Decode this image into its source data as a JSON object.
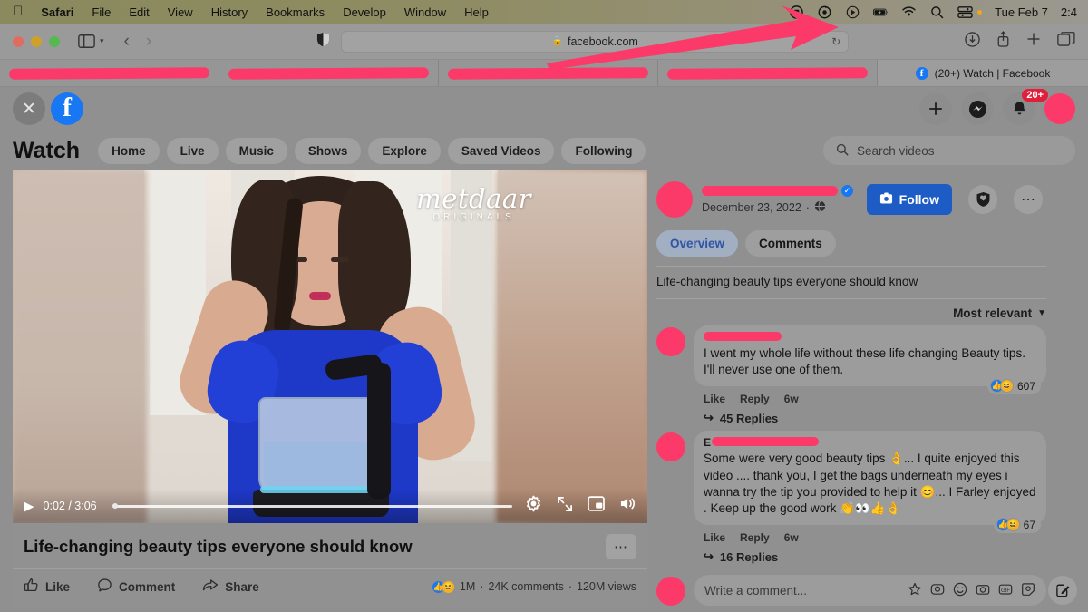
{
  "menubar": {
    "apple_icon": "apple-icon",
    "items": [
      {
        "label": "Safari",
        "bold": true
      },
      {
        "label": "File",
        "bold": false
      },
      {
        "label": "Edit",
        "bold": false
      },
      {
        "label": "View",
        "bold": false
      },
      {
        "label": "History",
        "bold": false
      },
      {
        "label": "Bookmarks",
        "bold": false
      },
      {
        "label": "Develop",
        "bold": false
      },
      {
        "label": "Window",
        "bold": false
      },
      {
        "label": "Help",
        "bold": false
      }
    ],
    "status_icons": [
      "record-stop-icon",
      "time-machine-icon",
      "screen-record-icon",
      "battery-charging-icon",
      "wifi-icon",
      "spotlight-search-icon",
      "control-center-icon"
    ],
    "clock": "Tue Feb 7",
    "time_partial": "2:4"
  },
  "safari": {
    "traffic_lights": [
      "close-button",
      "minimize-button",
      "zoom-button"
    ],
    "sidebar_icon": "sidebar-toggle-icon",
    "back_icon": "back-arrow-icon",
    "forward_icon": "forward-arrow-icon",
    "shield_icon": "privacy-shield-icon",
    "url": "facebook.com",
    "lock_icon": "lock-icon",
    "reload_icon": "reload-icon",
    "right_icons": [
      "downloads-icon",
      "share-icon",
      "new-tab-icon",
      "tab-overview-icon"
    ],
    "tabs": [
      {
        "label": "",
        "redacted": true
      },
      {
        "label": "",
        "redacted": true
      },
      {
        "label": "",
        "redacted": true
      },
      {
        "label": "",
        "redacted": true
      }
    ],
    "active_tab": {
      "title": "(20+) Watch | Facebook",
      "favicon": "facebook-icon"
    }
  },
  "fb_header": {
    "close_icon": "close-icon",
    "logo_icon": "facebook-logo-icon",
    "actions": [
      {
        "name": "create-button",
        "icon": "plus-icon"
      },
      {
        "name": "messenger-button",
        "icon": "messenger-icon"
      },
      {
        "name": "notifications-button",
        "icon": "bell-icon"
      }
    ],
    "notification_badge": "20+",
    "profile": "profile-avatar"
  },
  "watch": {
    "title": "Watch",
    "nav": [
      "Home",
      "Live",
      "Music",
      "Shows",
      "Explore",
      "Saved Videos",
      "Following"
    ],
    "search_placeholder": "Search videos",
    "search_icon": "search-icon"
  },
  "video": {
    "watermark_main": "metdaar",
    "watermark_sub": "ORIGINALS",
    "play_icon": "play-icon",
    "time": "0:02 / 3:06",
    "current_time": "0:02",
    "duration": "3:06",
    "progress_percent": 1,
    "controls": [
      {
        "name": "settings-button",
        "icon": "gear-icon"
      },
      {
        "name": "fullscreen-button",
        "icon": "expand-icon"
      },
      {
        "name": "miniplayer-button",
        "icon": "picture-in-picture-icon"
      },
      {
        "name": "volume-button",
        "icon": "speaker-icon"
      }
    ],
    "title": "Life-changing beauty tips everyone should know",
    "more_icon": "ellipsis-icon",
    "actions": [
      {
        "label": "Like",
        "icon": "thumbs-up-icon"
      },
      {
        "label": "Comment",
        "icon": "comment-bubble-icon"
      },
      {
        "label": "Share",
        "icon": "share-arrow-icon"
      }
    ],
    "stats": {
      "reactions": "1M",
      "comments": "24K comments",
      "views": "120M views",
      "separator": "·"
    }
  },
  "post": {
    "author_redacted": true,
    "verified_icon": "verified-badge-icon",
    "date": "December 23, 2022",
    "privacy_icon": "globe-icon",
    "separator": "·",
    "follow_label": "Follow",
    "follow_icon": "add-follow-icon",
    "save_icon": "save-shield-icon",
    "options_icon": "ellipsis-icon",
    "tabs": [
      {
        "label": "Overview",
        "selected": true
      },
      {
        "label": "Comments",
        "selected": false
      }
    ],
    "description": "Life-changing beauty tips everyone should know",
    "sort_label": "Most relevant",
    "sort_chevron": "chevron-down-icon"
  },
  "comments": [
    {
      "author_redacted": true,
      "name_initial": "",
      "text": "I went my whole life without these life changing Beauty tips. I'll never use one of them.",
      "like_label": "Like",
      "reply_label": "Reply",
      "time": "6w",
      "reaction_count": "607",
      "reactions": [
        "like-icon",
        "haha-icon"
      ],
      "replies_label": "45 Replies",
      "replies_icon": "reply-arrow-icon"
    },
    {
      "author_redacted": true,
      "name_initial": "E",
      "text": "Some were very good beauty tips 👌... I quite enjoyed this video .... thank you, I get the bags underneath my eyes i wanna try the tip you provided to help it 😊... I Farley enjoyed . Keep up the good work 👏👀👍👌",
      "like_label": "Like",
      "reply_label": "Reply",
      "time": "6w",
      "reaction_count": "67",
      "reactions": [
        "like-icon",
        "haha-icon"
      ],
      "replies_label": "16 Replies",
      "replies_icon": "reply-arrow-icon"
    }
  ],
  "comment_input": {
    "placeholder": "Write a comment...",
    "icons": [
      "sticker-icon",
      "avatar-sticker-icon",
      "emoji-icon",
      "camera-icon",
      "gif-icon",
      "sticker-face-icon"
    ]
  },
  "compose": {
    "icon": "compose-pencil-icon"
  },
  "annotation": {
    "type": "pink-arrow",
    "color": "#fc3a69",
    "points_to": "menubar-status-icons"
  },
  "colors": {
    "accent_blue": "#1877f2",
    "follow_blue": "#1d5cc4",
    "redaction_pink": "#fc3a69",
    "badge_red": "#e0203b",
    "tab_selected_text": "#2f55a4"
  }
}
